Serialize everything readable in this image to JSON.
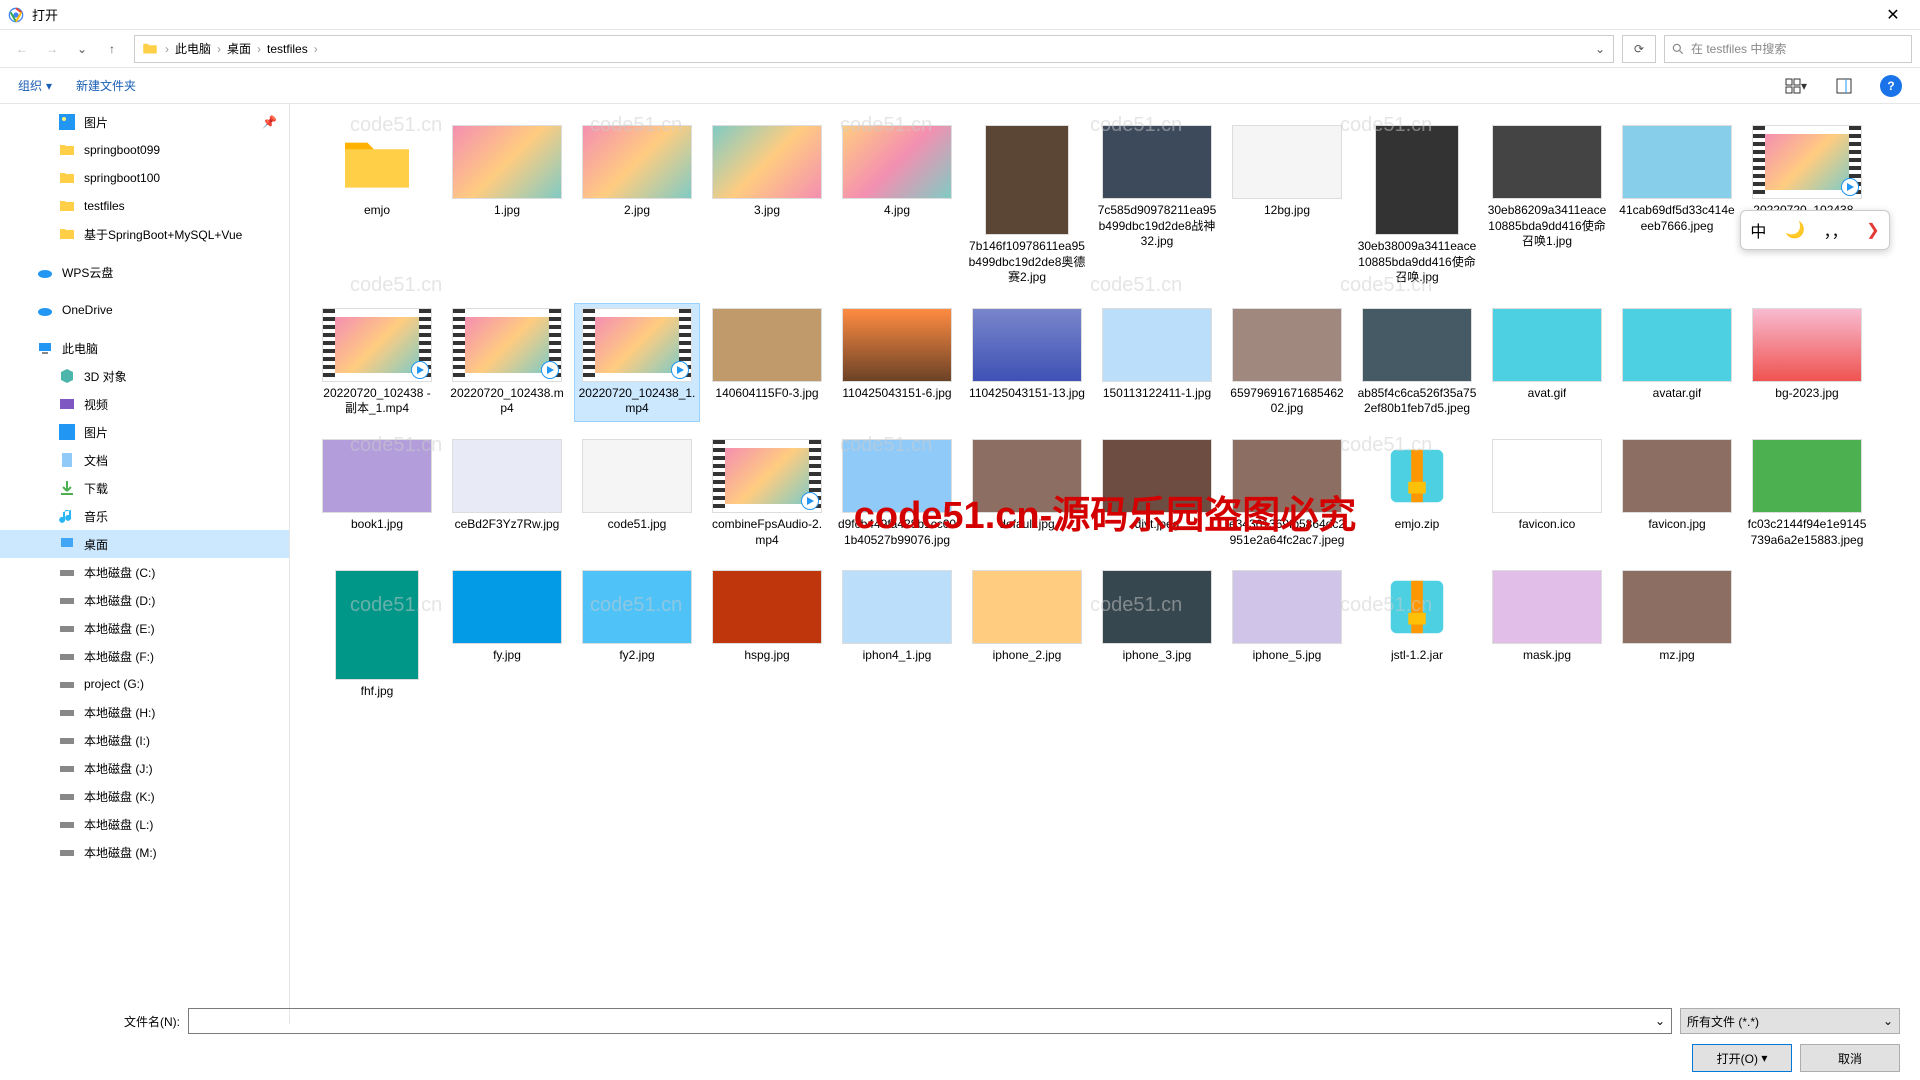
{
  "titlebar": {
    "title": "打开"
  },
  "nav": {
    "breadcrumb": [
      "此电脑",
      "桌面",
      "testfiles"
    ],
    "search_placeholder": "在 testfiles 中搜索"
  },
  "toolbar": {
    "organize": "组织",
    "new_folder": "新建文件夹"
  },
  "sidebar": {
    "pictures": "图片",
    "springboot099": "springboot099",
    "springboot100": "springboot100",
    "testfiles": "testfiles",
    "spring_project": "基于SpringBoot+MySQL+Vue",
    "wps_cloud": "WPS云盘",
    "onedrive": "OneDrive",
    "this_pc": "此电脑",
    "objects_3d": "3D 对象",
    "videos": "视频",
    "pictures2": "图片",
    "documents": "文档",
    "downloads": "下载",
    "music": "音乐",
    "desktop": "桌面",
    "drive_c": "本地磁盘 (C:)",
    "drive_d": "本地磁盘 (D:)",
    "drive_e": "本地磁盘 (E:)",
    "drive_f": "本地磁盘 (F:)",
    "drive_g": "project (G:)",
    "drive_h": "本地磁盘 (H:)",
    "drive_i": "本地磁盘 (I:)",
    "drive_j": "本地磁盘 (J:)",
    "drive_k": "本地磁盘 (K:)",
    "drive_l": "本地磁盘 (L:)",
    "drive_m": "本地磁盘 (M:)"
  },
  "files": [
    {
      "label": "emjo",
      "kind": "folder"
    },
    {
      "label": "1.jpg",
      "kind": "image",
      "bg": "linear-gradient(135deg,#f48fb1,#ffcc80,#80cbc4)"
    },
    {
      "label": "2.jpg",
      "kind": "image",
      "bg": "linear-gradient(135deg,#f48fb1,#ffcc80,#80cbc4)"
    },
    {
      "label": "3.jpg",
      "kind": "image",
      "bg": "linear-gradient(135deg,#80cbc4,#ffcc80,#f48fb1)"
    },
    {
      "label": "4.jpg",
      "kind": "image",
      "bg": "linear-gradient(135deg,#ffcc80,#f48fb1,#80cbc4)"
    },
    {
      "label": "7b146f10978611ea95b499dbc19d2de8奥德赛2.jpg",
      "kind": "image",
      "bg": "#5b4636",
      "tall": true
    },
    {
      "label": "7c585d90978211ea95b499dbc19d2de8战神32.jpg",
      "kind": "image",
      "bg": "#3c4a5c"
    },
    {
      "label": "12bg.jpg",
      "kind": "image",
      "bg": "#f5f5f5"
    },
    {
      "label": "30eb38009a3411eace10885bda9dd416使命召唤.jpg",
      "kind": "image",
      "bg": "#333",
      "tall": true
    },
    {
      "label": "30eb86209a3411eace10885bda9dd416使命召唤1.jpg",
      "kind": "image",
      "bg": "#444"
    },
    {
      "label": "41cab69df5d33c414eeeb7666.jpeg",
      "kind": "image",
      "bg": "#87ceeb"
    },
    {
      "label": "20220720_102438 - 副本.mp4",
      "kind": "video"
    },
    {
      "label": "20220720_102438 - 副本_1.mp4",
      "kind": "video"
    },
    {
      "label": "20220720_102438.mp4",
      "kind": "video"
    },
    {
      "label": "20220720_102438_1.mp4",
      "kind": "video",
      "selected": true
    },
    {
      "label": "140604115F0-3.jpg",
      "kind": "image",
      "bg": "#c19a6b"
    },
    {
      "label": "110425043151-6.jpg",
      "kind": "image",
      "bg": "linear-gradient(#ff8c42,#6b4226)"
    },
    {
      "label": "110425043151-13.jpg",
      "kind": "image",
      "bg": "linear-gradient(#7986cb,#3f51b5)"
    },
    {
      "label": "150113122411-1.jpg",
      "kind": "image",
      "bg": "#bbdefb"
    },
    {
      "label": "6597969167168546202.jpg",
      "kind": "image",
      "bg": "#a1887f"
    },
    {
      "label": "ab85f4c6ca526f35a752ef80b1feb7d5.jpeg",
      "kind": "image",
      "bg": "#455a64"
    },
    {
      "label": "avat.gif",
      "kind": "image",
      "bg": "#4dd0e1"
    },
    {
      "label": "avatar.gif",
      "kind": "image",
      "bg": "#4dd0e1"
    },
    {
      "label": "bg-2023.jpg",
      "kind": "image",
      "bg": "linear-gradient(#f8bbd0,#ef5350)"
    },
    {
      "label": "book1.jpg",
      "kind": "image",
      "bg": "#b39ddb"
    },
    {
      "label": "ceBd2F3Yz7Rw.jpg",
      "kind": "image",
      "bg": "#e8eaf6"
    },
    {
      "label": "code51.jpg",
      "kind": "image",
      "bg": "#f5f5f5"
    },
    {
      "label": "combineFpsAudio-2.mp4",
      "kind": "video"
    },
    {
      "label": "d9fcb449fa428b1cc001b40527b99076.jpg",
      "kind": "image",
      "bg": "#90caf9"
    },
    {
      "label": "default.jpg",
      "kind": "image",
      "bg": "#8d6e63"
    },
    {
      "label": "djyt.jpeg",
      "kind": "image",
      "bg": "#6d4c41"
    },
    {
      "label": "e34361369fb5864dc2951e2a64fc2ac7.jpeg",
      "kind": "image",
      "bg": "#8d6e63"
    },
    {
      "label": "emjo.zip",
      "kind": "archive"
    },
    {
      "label": "favicon.ico",
      "kind": "image",
      "bg": "#fff"
    },
    {
      "label": "favicon.jpg",
      "kind": "image",
      "bg": "#8d6e63"
    },
    {
      "label": "fc03c2144f94e1e9145739a6a2e15883.jpeg",
      "kind": "image",
      "bg": "#4caf50"
    },
    {
      "label": "fhf.jpg",
      "kind": "image",
      "bg": "#009688",
      "tall": true
    },
    {
      "label": "fy.jpg",
      "kind": "image",
      "bg": "#039be5"
    },
    {
      "label": "fy2.jpg",
      "kind": "image",
      "bg": "#4fc3f7"
    },
    {
      "label": "hspg.jpg",
      "kind": "image",
      "bg": "#bf360c"
    },
    {
      "label": "iphon4_1.jpg",
      "kind": "image",
      "bg": "#bbdefb"
    },
    {
      "label": "iphone_2.jpg",
      "kind": "image",
      "bg": "#ffcc80"
    },
    {
      "label": "iphone_3.jpg",
      "kind": "image",
      "bg": "#37474f"
    },
    {
      "label": "iphone_5.jpg",
      "kind": "image",
      "bg": "#d1c4e9"
    },
    {
      "label": "jstl-1.2.jar",
      "kind": "archive"
    },
    {
      "label": "mask.jpg",
      "kind": "image",
      "bg": "#e1bee7"
    },
    {
      "label": "mz.jpg",
      "kind": "image",
      "bg": "#8d6e63"
    }
  ],
  "watermark_center": "code51.cn-源码乐园盗图必究",
  "watermark_bg_texts": [
    "code51.cn",
    "code51.cn",
    "code51.cn",
    "code51.cn",
    "code51.cn",
    "code51.cn",
    "code51.cn",
    "code51.cn",
    "code51.cn",
    "code51.cn",
    "code51.cn",
    "code51.cn",
    "code51.cn",
    "code51.cn",
    "code51.cn"
  ],
  "ime": {
    "lang": "中",
    "s1": "🌙",
    "s2": "，，",
    "s3": "❯"
  },
  "footer": {
    "filename_label": "文件名(N):",
    "filename_value": "",
    "filter": "所有文件 (*.*)",
    "open_btn": "打开(O)",
    "cancel_btn": "取消"
  }
}
